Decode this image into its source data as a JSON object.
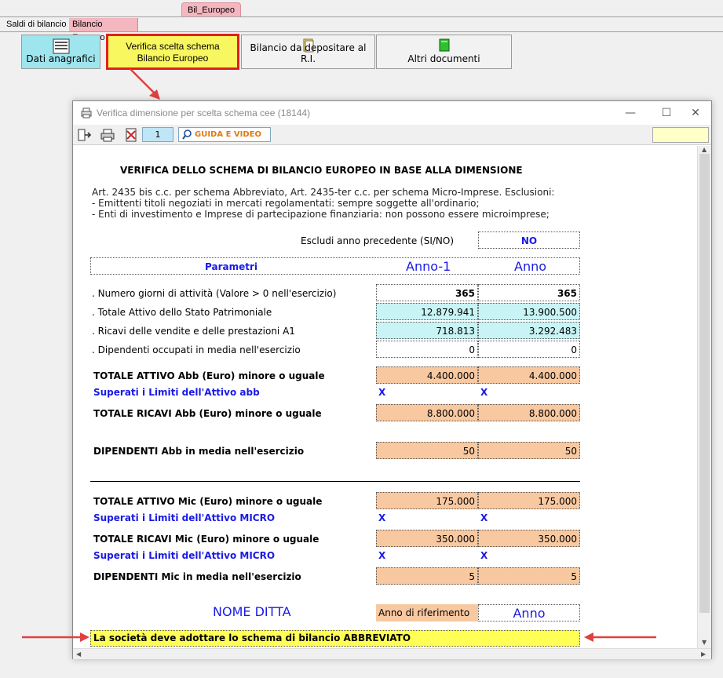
{
  "top_tab": "Bil_Europeo",
  "tabs": [
    "Saldi di bilancio",
    "Bilancio Europeo"
  ],
  "buttons": {
    "dati": "Dati anagrafici",
    "verifica_line1": "Verifica scelta schema",
    "verifica_line2": "Bilancio Europeo",
    "bilancio": "Bilancio da depositare al R.I.",
    "altri": "Altri documenti"
  },
  "dialog": {
    "title": "Verifica dimensione per scelta schema cee (18144)",
    "page_number": "1",
    "guida_label": "GUIDA E VIDEO",
    "heading": "VERIFICA DELLO SCHEMA DI BILANCIO EUROPEO IN BASE ALLA DIMENSIONE",
    "notes": [
      "Art. 2435 bis c.c. per schema Abbreviato, Art. 2435-ter c.c. per schema Micro-Imprese. Esclusioni:",
      "- Emittenti titoli negoziati in mercati regolamentati: sempre soggette all'ordinario;",
      "- Enti di investimento e Imprese di partecipazione finanziaria: non possono essere microimprese;"
    ],
    "escludi_label": "Escludi anno precedente (SI/NO)",
    "escludi_value": "NO",
    "param_header": "Parametri",
    "col_prev": "Anno-1",
    "col_curr": "Anno",
    "rows": [
      {
        "label": ". Numero giorni di attività (Valore > 0 nell'esercizio)",
        "prev": "365",
        "curr": "365"
      },
      {
        "label": ". Totale Attivo dello Stato Patrimoniale",
        "prev": "12.879.941",
        "curr": "13.900.500"
      },
      {
        "label": ". Ricavi delle vendite e delle prestazioni A1",
        "prev": "718.813",
        "curr": "3.292.483"
      },
      {
        "label": ". Dipendenti occupati in media nell'esercizio",
        "prev": "0",
        "curr": "0"
      }
    ],
    "abb_attivo_label": "TOTALE ATTIVO Abb (Euro) minore o uguale",
    "abb_attivo_prev": "4.400.000",
    "abb_attivo_curr": "4.400.000",
    "abb_superati_label": "Superati i Limiti dell'Attivo abb",
    "x_mark": "X",
    "abb_ricavi_label": "TOTALE RICAVI Abb (Euro) minore o uguale",
    "abb_ricavi_prev": "8.800.000",
    "abb_ricavi_curr": "8.800.000",
    "abb_dip_label": "DIPENDENTI Abb in media nell'esercizio",
    "abb_dip_prev": "50",
    "abb_dip_curr": "50",
    "mic_attivo_label": "TOTALE ATTIVO Mic (Euro) minore o uguale",
    "mic_attivo_prev": "175.000",
    "mic_attivo_curr": "175.000",
    "mic_superati_label": "Superati i Limiti dell'Attivo MICRO",
    "mic_ricavi_label": "TOTALE RICAVI Mic (Euro) minore o uguale",
    "mic_ricavi_prev": "350.000",
    "mic_ricavi_curr": "350.000",
    "mic_superati2_label": "Superati i Limiti dell'Attivo MICRO",
    "mic_dip_label": "DIPENDENTI Mic in media nell'esercizio",
    "mic_dip_prev": "5",
    "mic_dip_curr": "5",
    "nome_ditta": "NOME DITTA",
    "anno_rif_label": "Anno di riferimento",
    "anno_rif_value": "Anno",
    "result": "La società deve adottare lo schema di bilancio ABBREVIATO"
  },
  "colors": {
    "accent_red": "#e02020",
    "cyan": "#c8f4f6",
    "peach": "#f8c8a0",
    "result_yellow": "#ffff55",
    "blue_text": "#1a1ae6"
  }
}
